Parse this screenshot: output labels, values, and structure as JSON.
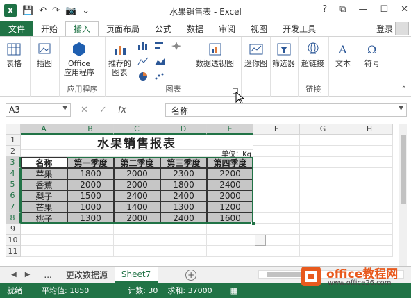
{
  "window": {
    "title": "水果销售表 - Excel",
    "controls": [
      "?",
      "⧉",
      "—",
      "☐",
      "✕"
    ],
    "login": "登录"
  },
  "ribbon_tabs": [
    "文件",
    "开始",
    "插入",
    "页面布局",
    "公式",
    "数据",
    "审阅",
    "视图",
    "开发工具"
  ],
  "active_tab": "插入",
  "ribbon": {
    "groups": {
      "tables_label": "表格",
      "illustrations_label": "插图",
      "apps_label": "Office\n应用程序",
      "addins_group": "应用程序",
      "recommended_charts": "推荐的\n图表",
      "pivotchart": "数据透视图",
      "charts_group": "图表",
      "sparklines": "迷你图",
      "filters": "筛选器",
      "hyperlink": "超链接",
      "links_group": "链接",
      "text": "文本",
      "symbol": "符号"
    }
  },
  "formula_bar": {
    "name_box": "A3",
    "formula": "名称",
    "cancel": "✕",
    "enter": "✓",
    "fx": "fx"
  },
  "columns": [
    "A",
    "B",
    "C",
    "D",
    "E",
    "F",
    "G",
    "H"
  ],
  "rows": [
    "1",
    "2",
    "3",
    "4",
    "5",
    "6",
    "7",
    "8",
    "9",
    "10",
    "11"
  ],
  "sheet": {
    "title": "水果销售报表",
    "unit": "单位：Kg",
    "headers": [
      "名称",
      "第一季度",
      "第二季度",
      "第三季度",
      "第四季度"
    ],
    "data": [
      [
        "苹果",
        "1800",
        "2000",
        "2300",
        "2200"
      ],
      [
        "香蕉",
        "2000",
        "2000",
        "1800",
        "2400"
      ],
      [
        "梨子",
        "1500",
        "2400",
        "2400",
        "2000"
      ],
      [
        "芒果",
        "1000",
        "1400",
        "1300",
        "1200"
      ],
      [
        "桃子",
        "1300",
        "2000",
        "2400",
        "1600"
      ]
    ]
  },
  "sheet_tabs": [
    "...",
    "更改数据源",
    "Sheet7"
  ],
  "active_sheet": "Sheet7",
  "status": {
    "ready": "就绪",
    "average": "平均值: 1850",
    "count": "计数: 30",
    "sum": "求和: 37000"
  },
  "watermark": {
    "brand": "office教程网",
    "url": "www.office26.com"
  },
  "colors": {
    "excel_green": "#217346",
    "selection_gray": "#c6c6c6",
    "watermark_orange": "#e85a1e"
  }
}
